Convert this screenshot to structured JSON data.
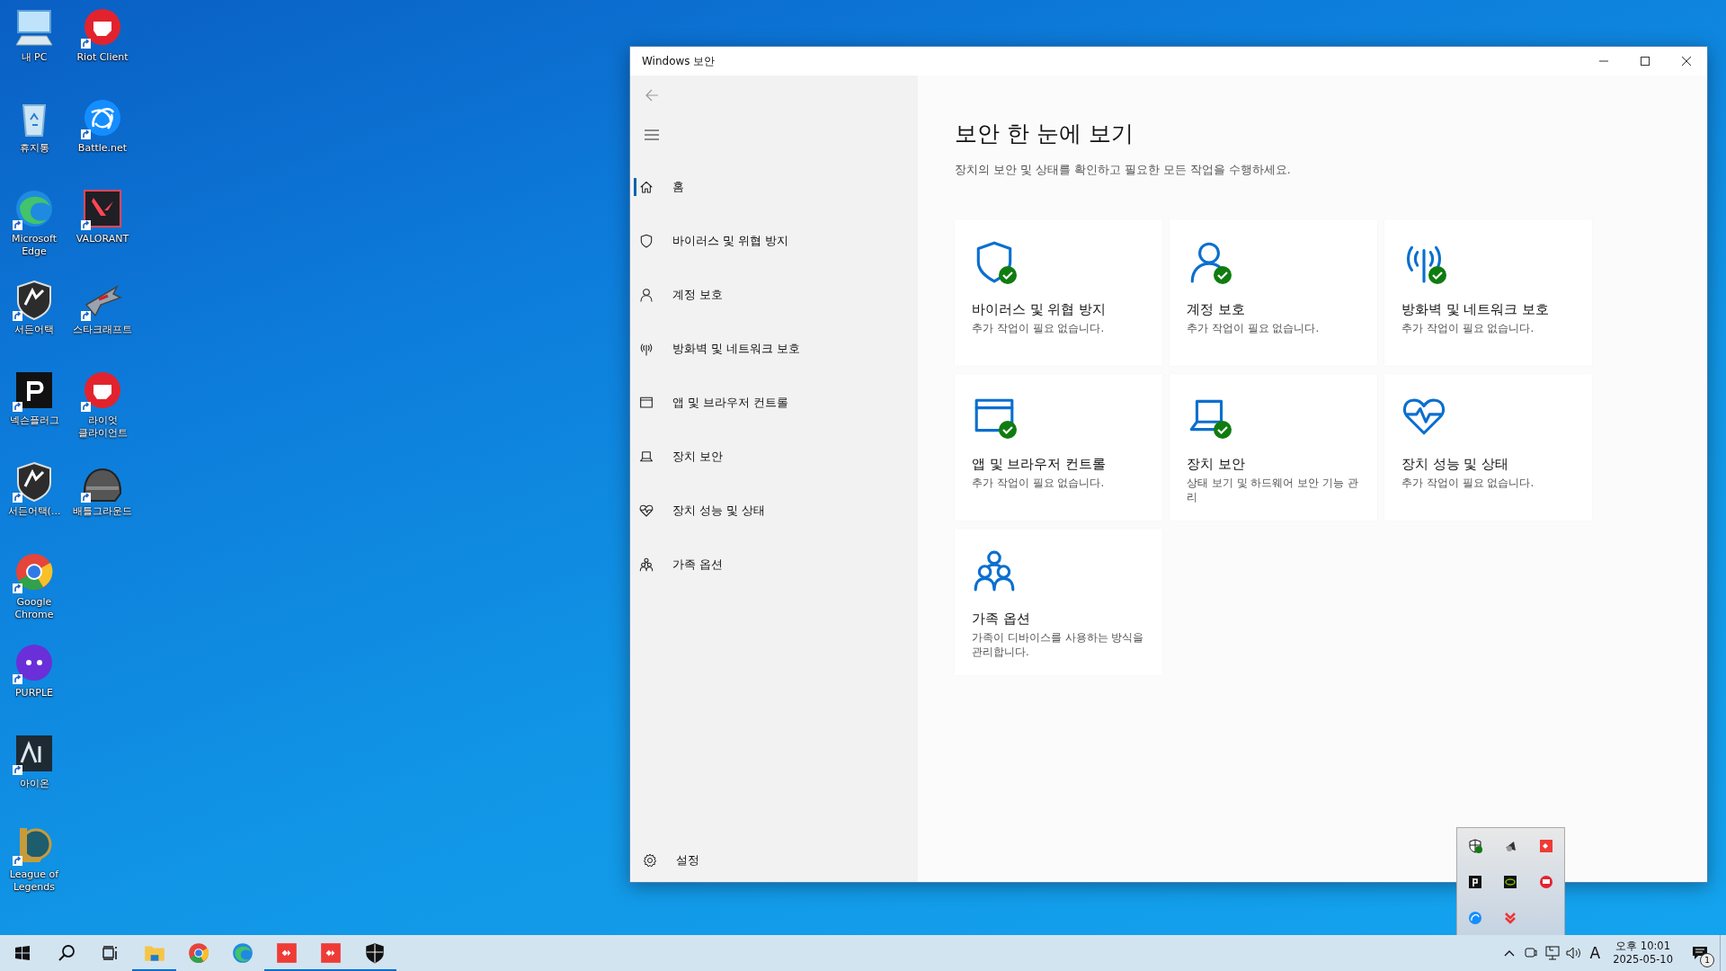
{
  "desktop": {
    "columns": [
      [
        {
          "label": "내 PC",
          "kind": "computer",
          "shortcut": false
        },
        {
          "label": "휴지통",
          "kind": "recycle-bin",
          "shortcut": false
        },
        {
          "label": "Microsoft Edge",
          "kind": "wave-browser",
          "shortcut": true
        },
        {
          "label": "서든어택",
          "kind": "crest",
          "shortcut": true
        },
        {
          "label": "넥슨플러그",
          "kind": "black-p",
          "shortcut": true
        },
        {
          "label": "서든어택(...",
          "kind": "crest",
          "shortcut": true
        },
        {
          "label": "Google Chrome",
          "kind": "round-browser",
          "shortcut": true
        },
        {
          "label": "PURPLE",
          "kind": "purple-blob",
          "shortcut": true
        },
        {
          "label": "아이온",
          "kind": "dark-logo",
          "shortcut": true
        },
        {
          "label": "League of Legends",
          "kind": "gold-logo",
          "shortcut": true
        }
      ],
      [
        {
          "label": "Riot Client",
          "kind": "red-fist",
          "shortcut": true
        },
        {
          "label": "Battle.net",
          "kind": "blue-swirl",
          "shortcut": true
        },
        {
          "label": "VALORANT",
          "kind": "red-v",
          "shortcut": true
        },
        {
          "label": "스타크래프트",
          "kind": "spaceship",
          "shortcut": true
        },
        {
          "label": "라이엇 클라이언트",
          "kind": "red-fist",
          "shortcut": true
        },
        {
          "label": "배틀그라운드",
          "kind": "helmet",
          "shortcut": true
        }
      ]
    ]
  },
  "window": {
    "title": "Windows 보안"
  },
  "sidebar": {
    "items": [
      {
        "label": "홈",
        "kind": "home",
        "selected": true
      },
      {
        "label": "바이러스 및 위협 방지",
        "kind": "shield",
        "selected": false
      },
      {
        "label": "계정 보호",
        "kind": "person",
        "selected": false
      },
      {
        "label": "방화벽 및 네트워크 보호",
        "kind": "antenna",
        "selected": false
      },
      {
        "label": "앱 및 브라우저 컨트롤",
        "kind": "browser",
        "selected": false
      },
      {
        "label": "장치 보안",
        "kind": "laptop",
        "selected": false
      },
      {
        "label": "장치 성능 및 상태",
        "kind": "heart",
        "selected": false
      },
      {
        "label": "가족 옵션",
        "kind": "family",
        "selected": false
      }
    ],
    "settings": "설정"
  },
  "main": {
    "title": "보안 한 눈에 보기",
    "subtitle": "장치의 보안 및 상태를 확인하고 필요한 모든 작업을 수행하세요.",
    "cards": [
      {
        "title": "바이러스 및 위협 방지",
        "status": "추가 작업이 필요 없습니다.",
        "kind": "shield",
        "ok": true
      },
      {
        "title": "계정 보호",
        "status": "추가 작업이 필요 없습니다.",
        "kind": "person",
        "ok": true
      },
      {
        "title": "방화벽 및 네트워크 보호",
        "status": "추가 작업이 필요 없습니다.",
        "kind": "antenna",
        "ok": true
      },
      {
        "title": "앱 및 브라우저 컨트롤",
        "status": "추가 작업이 필요 없습니다.",
        "kind": "browser",
        "ok": true
      },
      {
        "title": "장치 보안",
        "status": "상태 보기 및 하드웨어 보안 기능 관리",
        "kind": "laptop",
        "ok": true
      },
      {
        "title": "장치 성능 및 상태",
        "status": "추가 작업이 필요 없습니다.",
        "kind": "heart",
        "ok": false
      },
      {
        "title": "가족 옵션",
        "status": "가족이 디바이스를 사용하는 방식을 관리합니다.",
        "kind": "family",
        "ok": false
      }
    ]
  },
  "taskbar": {
    "apps": [
      {
        "kind": "folder",
        "running": true
      },
      {
        "kind": "round-browser",
        "running": false
      },
      {
        "kind": "wave-browser",
        "running": false
      },
      {
        "kind": "red-app",
        "running": true
      },
      {
        "kind": "red-app",
        "running": true
      },
      {
        "kind": "shield",
        "running": true
      }
    ],
    "input_mode": "A",
    "time": "오후 10:01",
    "date": "2025-05-10",
    "notifications": "1"
  }
}
